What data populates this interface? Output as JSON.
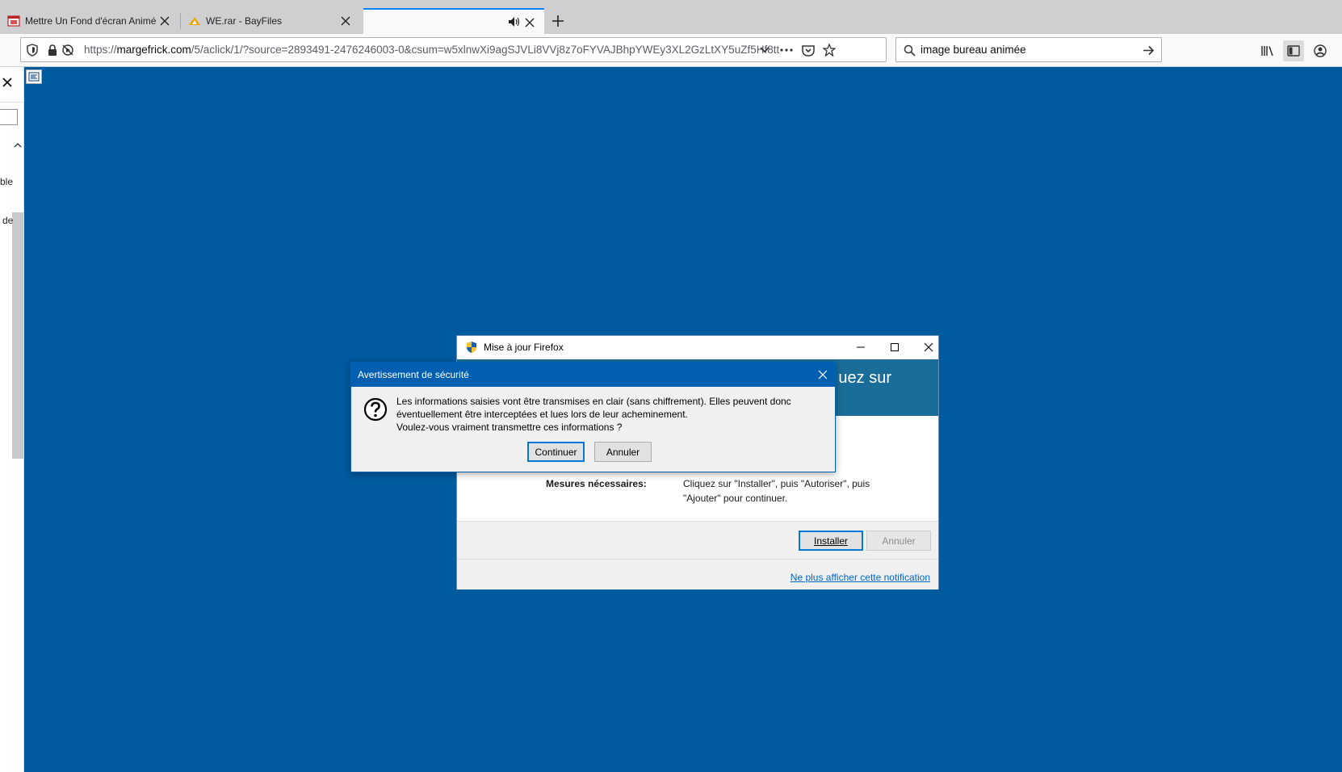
{
  "tabs": [
    {
      "title": "Mettre Un Fond d'écran Animé",
      "favicon": "film-icon",
      "active": false
    },
    {
      "title": "WE.rar - BayFiles",
      "favicon": "bayfiles-icon",
      "active": false
    },
    {
      "title": "",
      "favicon": "",
      "active": true,
      "audio": "speaker-icon"
    }
  ],
  "navbar": {
    "url_prefix": "https://",
    "url_domain": "margefrick.com",
    "url_rest": "/5/aclick/1/?source=2893491-2476246003-0&csum=w5xlnwXi9agSJVLi8VVj8z7oFYVAJBhpYWEy3XL2GzLtXY5uZf5Hf8tt",
    "search_value": "image bureau animée"
  },
  "sidebar": {
    "text_1": "ble",
    "text_2": "de"
  },
  "fx_dialog": {
    "title": "Mise à jour Firefox",
    "banner_text": "uez sur",
    "label": "Mesures nécessaires:",
    "description": "Cliquez sur \"Installer\", puis \"Autoriser\", puis \"Ajouter\" pour continuer.",
    "install_label": "Installer",
    "cancel_label": "Annuler",
    "link_label": "Ne plus afficher cette notification"
  },
  "security_dialog": {
    "title": "Avertissement de sécurité",
    "message_line1": "Les informations saisies vont être transmises en clair (sans chiffrement). Elles peuvent donc",
    "message_line2": "éventuellement être interceptées et lues lors de leur acheminement.",
    "message_line3": "Voulez-vous vraiment transmettre ces informations ?",
    "continue_label": "Continuer",
    "cancel_label": "Annuler"
  },
  "colors": {
    "page_background": "#005a9e",
    "banner": "#1b6d99",
    "security_titlebar": "#005fb0",
    "link": "#0066cc"
  }
}
